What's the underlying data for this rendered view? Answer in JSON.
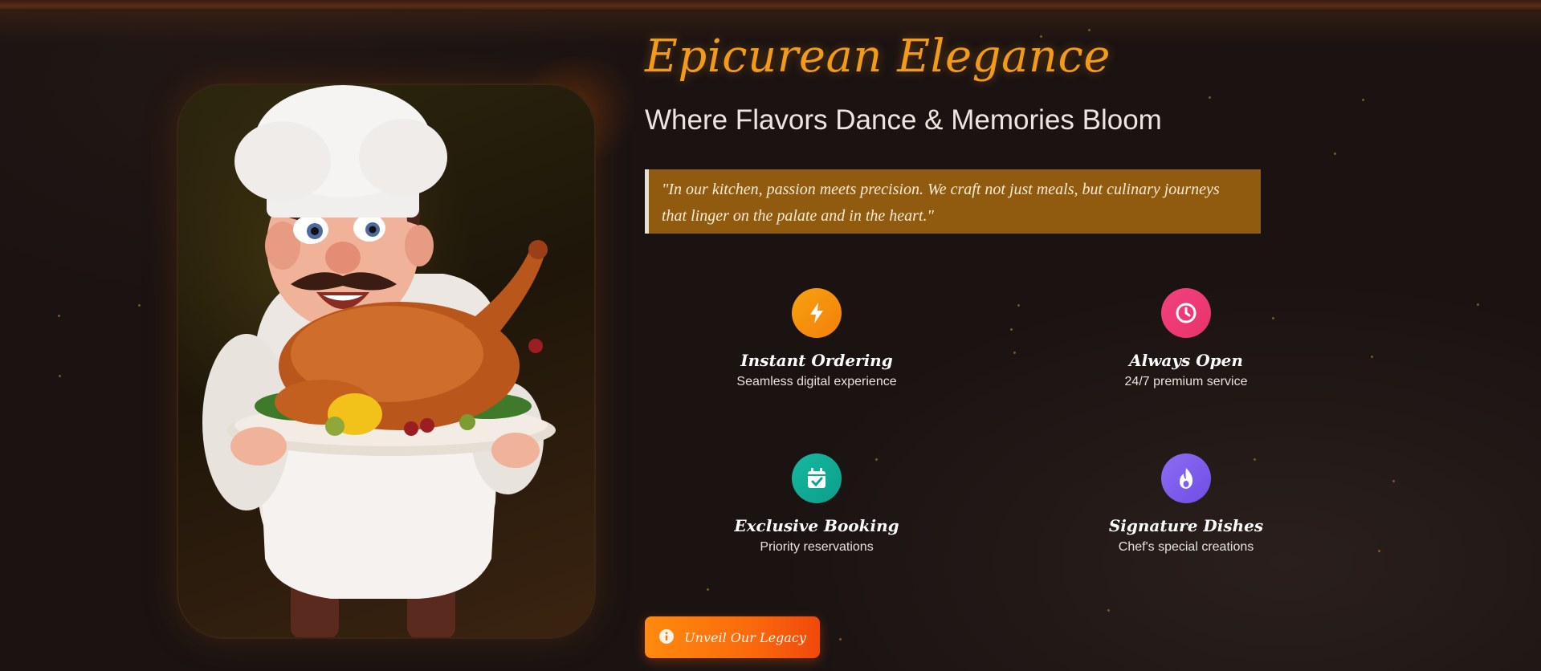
{
  "colors": {
    "accent": "#f39a18",
    "quote_bg": "#915b0f",
    "cta_start": "#ff8a0f",
    "cta_end": "#f0490b"
  },
  "hero": {
    "brand_title": "Epicurean Elegance",
    "subtitle": "Where Flavors Dance & Memories Bloom",
    "quote": "\"In our kitchen, passion meets precision. We craft not just meals, but culinary journeys that linger on the palate and in the heart.\"",
    "image_description_icon": "chef-with-roast-turkey"
  },
  "features": [
    {
      "icon": "lightning-icon",
      "title": "Instant Ordering",
      "desc": "Seamless digital experience",
      "color": "#f59a10"
    },
    {
      "icon": "clock-icon",
      "title": "Always Open",
      "desc": "24/7 premium service",
      "color": "#ee3b75"
    },
    {
      "icon": "calendar-check-icon",
      "title": "Exclusive Booking",
      "desc": "Priority reservations",
      "color": "#12b09a"
    },
    {
      "icon": "flame-icon",
      "title": "Signature Dishes",
      "desc": "Chef's special creations",
      "color": "#7e5eee"
    }
  ],
  "cta": {
    "label": "Unveil Our Legacy",
    "icon": "info-circle-icon"
  }
}
